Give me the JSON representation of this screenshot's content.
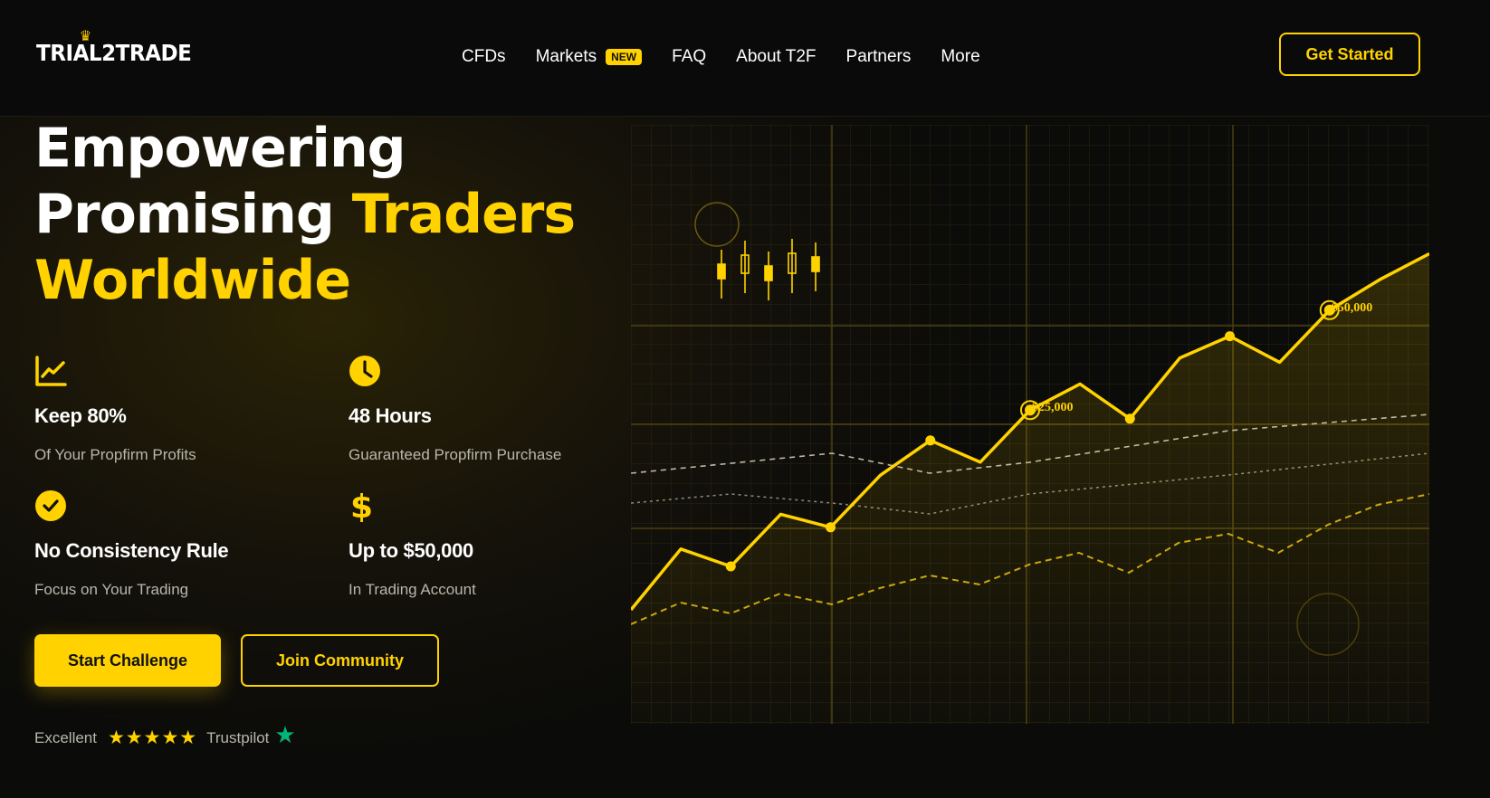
{
  "brand": {
    "logo_text": "TRIAL2TRADE",
    "accent_color": "#ffd200"
  },
  "nav": {
    "items": [
      {
        "label": "CFDs"
      },
      {
        "label": "Markets",
        "badge": "NEW"
      },
      {
        "label": "FAQ"
      },
      {
        "label": "About T2F"
      },
      {
        "label": "Partners"
      },
      {
        "label": "More"
      }
    ],
    "cta": "Get Started"
  },
  "hero": {
    "title_line1": "Empowering",
    "title_line2_white": "Promising",
    "title_line2_yellow": "Traders",
    "title_line3": "Worldwide"
  },
  "features": [
    {
      "icon": "chart-line-icon",
      "title": "Keep 80%",
      "subtitle": "Of Your Propfirm Profits"
    },
    {
      "icon": "clock-icon",
      "title": "48 Hours",
      "subtitle": "Guaranteed Propfirm Purchase"
    },
    {
      "icon": "check-circle-icon",
      "title": "No Consistency Rule",
      "subtitle": "Focus on Your Trading"
    },
    {
      "icon": "dollar-icon",
      "title": "Up to $50,000",
      "subtitle": "In Trading Account"
    }
  ],
  "buttons": {
    "primary": "Start Challenge",
    "secondary": "Join Community"
  },
  "rating": {
    "label": "Excellent",
    "stars": "★★★★★",
    "provider": "Trustpilot",
    "star_count": 5
  },
  "chart_data": {
    "type": "line",
    "annotations": [
      "$25,000",
      "$50,000"
    ],
    "series": [
      {
        "values": [
          2.0,
          3.4,
          3.0,
          4.2,
          3.9,
          5.1,
          5.9,
          5.4,
          6.6,
          7.2,
          6.4,
          7.8,
          8.3,
          7.7,
          8.9,
          9.6,
          10.2
        ]
      }
    ]
  }
}
